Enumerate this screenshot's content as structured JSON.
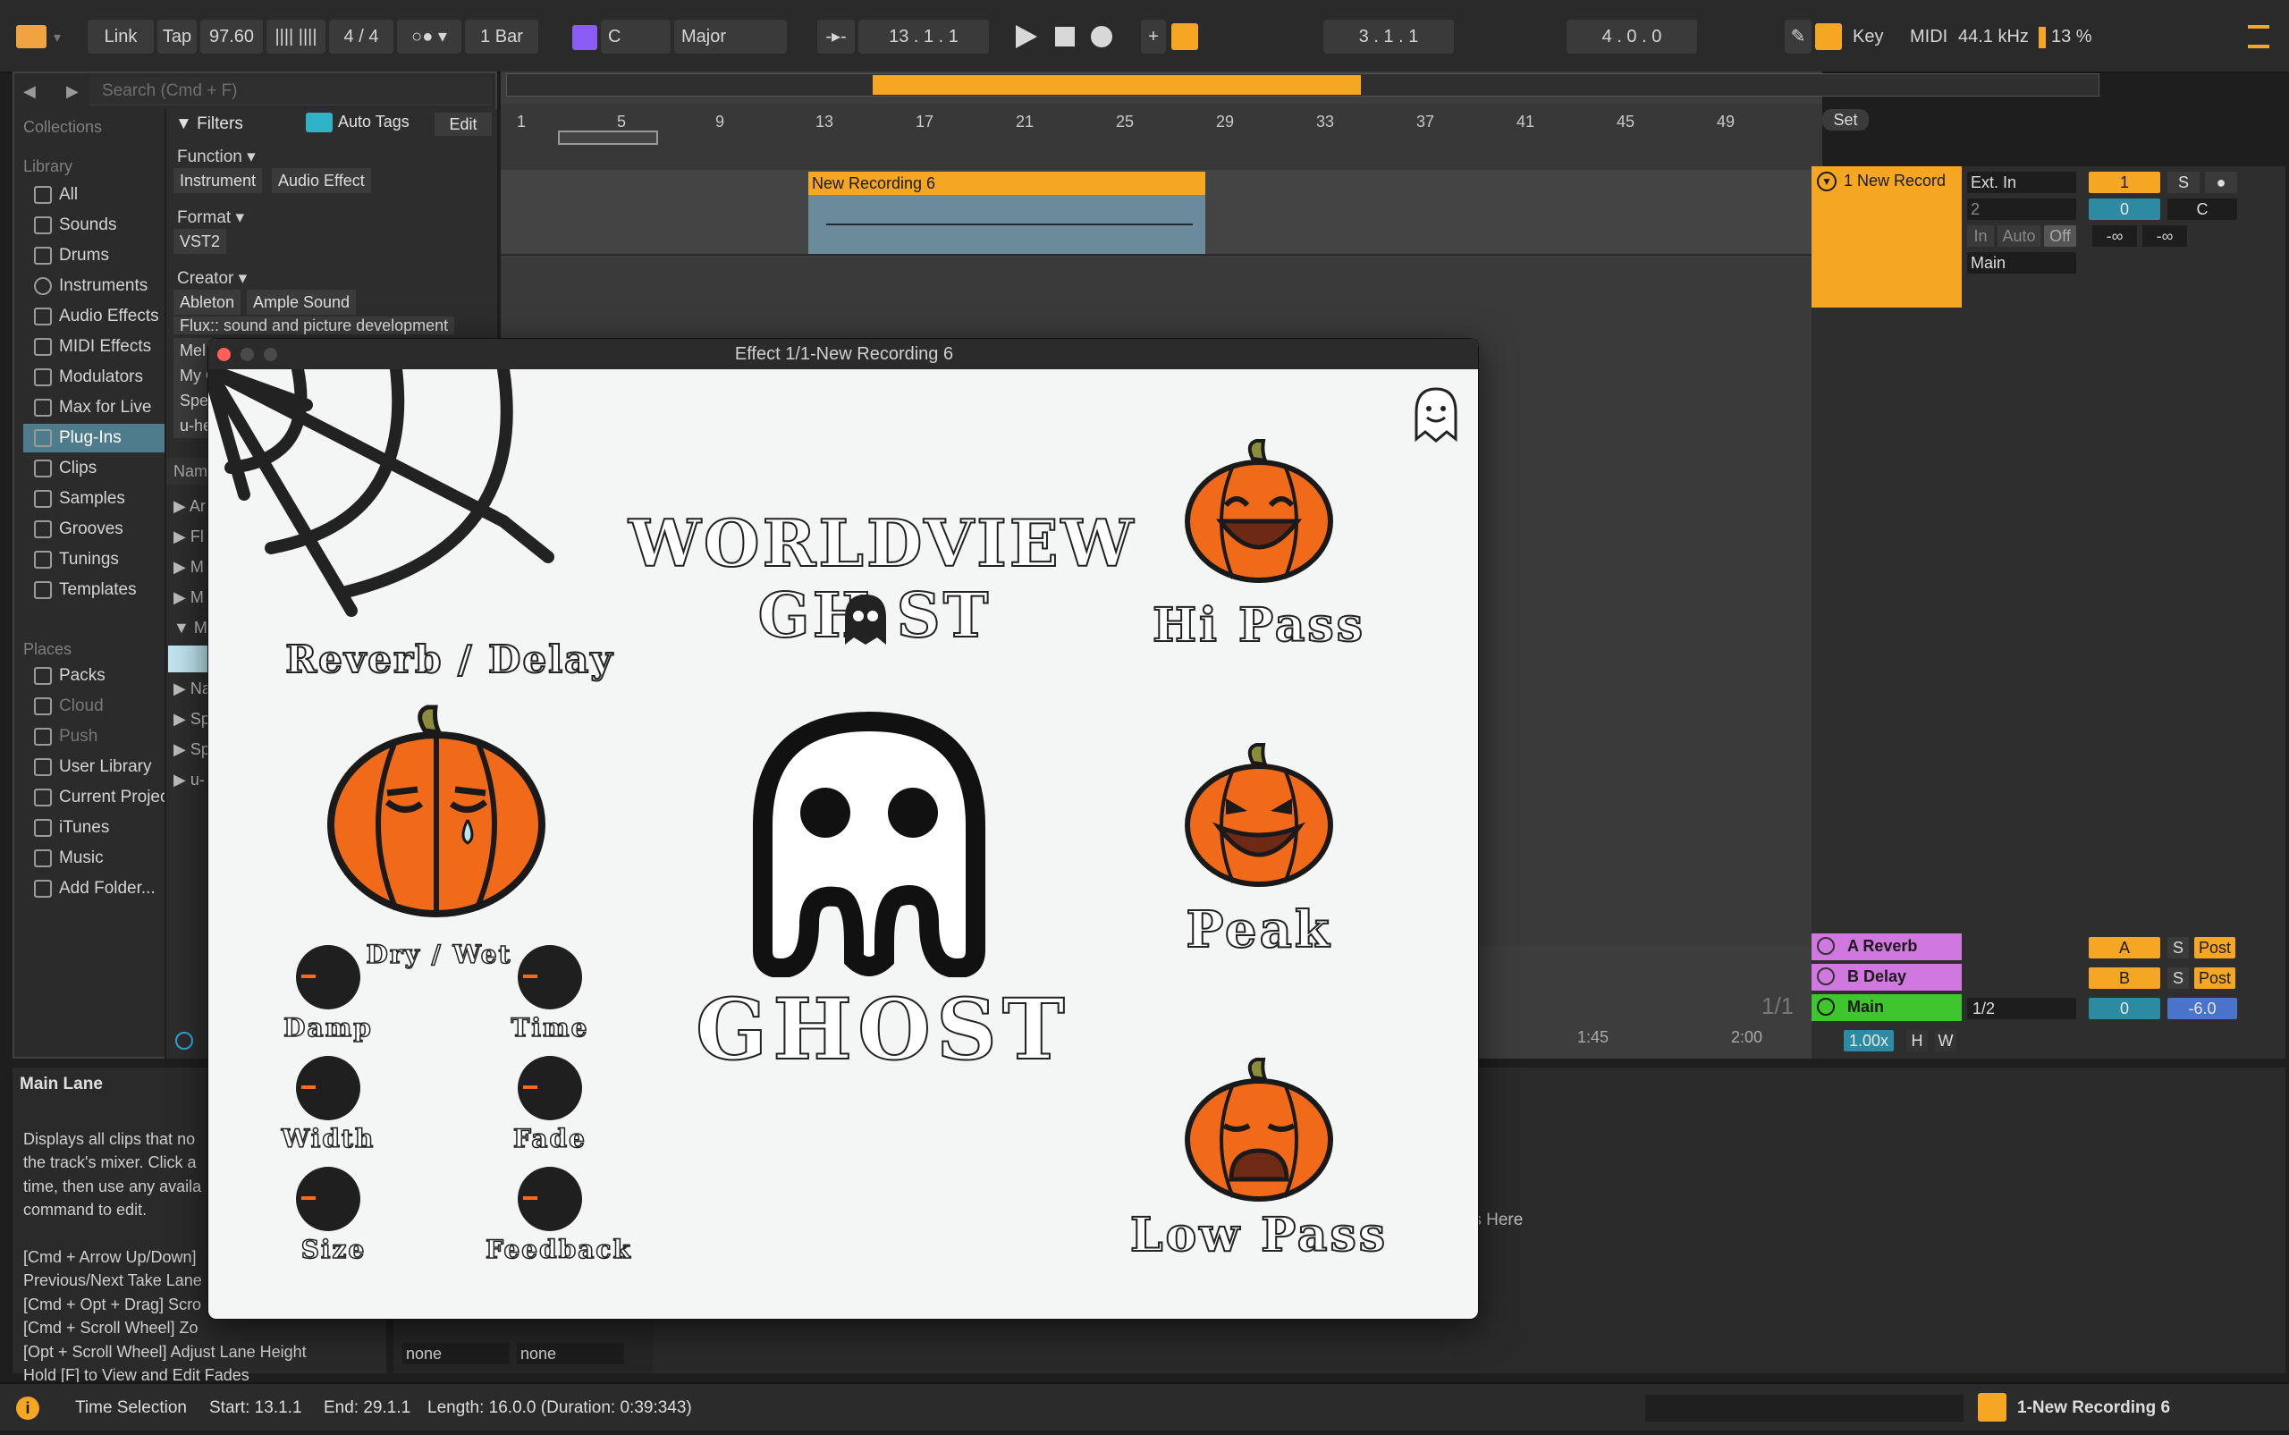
{
  "topbar": {
    "link": "Link",
    "tap": "Tap",
    "tempo": "97.60",
    "signature": "4 / 4",
    "quant": "1 Bar",
    "key": "C",
    "scale": "Major",
    "position": "13 .   1 .   1",
    "loop_start": "3 .   1 .   1",
    "loop_length": "4 .   0 .   0",
    "key_label": "Key",
    "midi_label": "MIDI",
    "sample_rate": "44.1 kHz",
    "cpu": "13 %"
  },
  "browser": {
    "search_placeholder": "Search (Cmd + F)",
    "collections": "Collections",
    "library": "Library",
    "places": "Places",
    "filters": "Filters",
    "auto_tags": "Auto Tags",
    "edit": "Edit",
    "library_items": [
      "All",
      "Sounds",
      "Drums",
      "Instruments",
      "Audio Effects",
      "MIDI Effects",
      "Modulators",
      "Max for Live",
      "Plug-Ins",
      "Clips",
      "Samples",
      "Grooves",
      "Tunings",
      "Templates"
    ],
    "place_items": [
      "Packs",
      "Cloud",
      "Push",
      "User Library",
      "Current Project",
      "iTunes",
      "Music",
      "Add Folder..."
    ],
    "function_head": "Function",
    "function_chips": [
      "Instrument",
      "Audio Effect"
    ],
    "format_head": "Format",
    "format_chips": [
      "VST2"
    ],
    "creator_head": "Creator",
    "creator_chips": [
      "Ableton",
      "Ample Sound"
    ],
    "creator_more": [
      "Flux:: sound and picture development",
      "Mel",
      "My C",
      "Spe",
      "u-he"
    ],
    "name_header": "Name",
    "tree_items": [
      "Ar",
      "Fl",
      "M",
      "M",
      "M",
      "",
      "Na",
      "Sp",
      "Sp",
      "u-"
    ]
  },
  "arrangement": {
    "ruler": [
      "1",
      "5",
      "9",
      "13",
      "17",
      "21",
      "25",
      "29",
      "33",
      "37",
      "41",
      "45",
      "49"
    ],
    "clip_name": "New Recording 6",
    "set_label": "Set",
    "track_name": "1 New Record",
    "input": "Ext. In",
    "channel": "2",
    "monitor": [
      "In",
      "Auto",
      "Off"
    ],
    "output": "Main",
    "track_number": "1",
    "solo": "S",
    "volume": "0",
    "pan": "C",
    "meter_l": "-∞",
    "meter_r": "-∞",
    "returns": [
      {
        "name": "A Reverb",
        "letter": "A",
        "solo": "S",
        "post": "Post"
      },
      {
        "name": "B Delay",
        "letter": "B",
        "solo": "S",
        "post": "Post"
      }
    ],
    "main": {
      "name": "Main",
      "fraction": "1/2",
      "vol": "0",
      "gain": "-6.0"
    },
    "page": "1/1",
    "time_1": "1:45",
    "time_2": "2:00",
    "zoom": "1.00x",
    "h": "H",
    "w": "W"
  },
  "plugin": {
    "window_title": "Effect 1/1-New Recording 6",
    "title_line1": "WORLDVIEW",
    "title_line2": "GH  ST",
    "reverb_delay": "Reverb / Delay",
    "dry_wet": "Dry / Wet",
    "knobs": [
      "Damp",
      "Time",
      "Width",
      "Fade",
      "Size",
      "Feedback"
    ],
    "ghost_label": "GHOST",
    "hi_pass": "Hi Pass",
    "peak": "Peak",
    "low_pass": "Low Pass"
  },
  "info": {
    "title": "Main Lane",
    "lines": [
      "Displays all clips that no",
      "the track's mixer. Click a",
      "time, then use any availa",
      "command to edit.",
      "",
      "[Cmd + Arrow Up/Down]",
      "Previous/Next Take Lane",
      "[Cmd + Opt + Drag] Scro",
      "[Cmd + Scroll Wheel] Zo",
      "[Opt + Scroll Wheel] Adjust Lane Height",
      "Hold [F] to View and Edit Fades"
    ],
    "none_1": "none",
    "none_2": "none",
    "drop_hint": "ects Here"
  },
  "status": {
    "mode": "Time Selection",
    "start": "Start: 13.1.1",
    "end": "End: 29.1.1",
    "length": "Length: 16.0.0  (Duration: 0:39:343)",
    "track": "1-New Recording 6"
  },
  "colors": {
    "accent": "#f5a623",
    "clip_audio": "#6b8a9c",
    "return": "#d177e0",
    "main": "#3fc62e",
    "pumpkin": "#f06a1a"
  }
}
